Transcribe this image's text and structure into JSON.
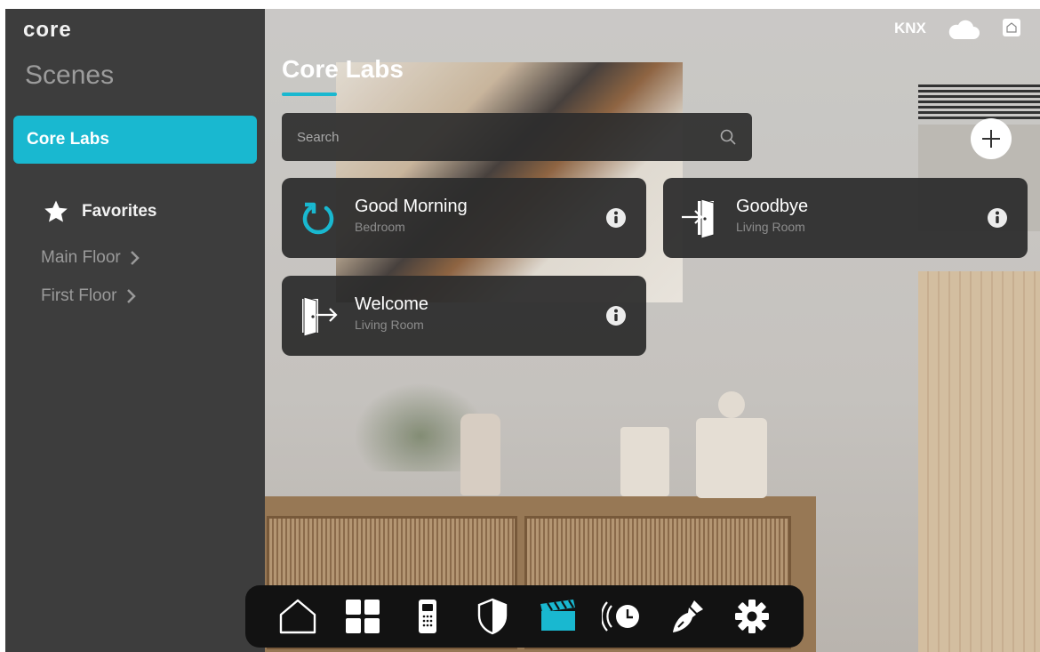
{
  "brand": {
    "logo_text": "core"
  },
  "sidebar": {
    "section_title": "Scenes",
    "active_item": "Core Labs",
    "favorites_label": "Favorites",
    "floors": [
      {
        "label": "Main Floor"
      },
      {
        "label": "First Floor"
      }
    ]
  },
  "header": {
    "title": "Core Labs",
    "protocol_label": "KNX"
  },
  "search": {
    "placeholder": "Search",
    "value": ""
  },
  "scenes": [
    {
      "name": "Good Morning",
      "room": "Bedroom",
      "icon": "refresh-icon"
    },
    {
      "name": "Goodbye",
      "room": "Living Room",
      "icon": "door-enter-icon"
    },
    {
      "name": "Welcome",
      "room": "Living Room",
      "icon": "door-exit-icon"
    }
  ],
  "dock": {
    "items": [
      {
        "icon": "home-icon",
        "active": false
      },
      {
        "icon": "grid-icon",
        "active": false
      },
      {
        "icon": "intercom-icon",
        "active": false
      },
      {
        "icon": "shield-icon",
        "active": false
      },
      {
        "icon": "clapperboard-icon",
        "active": true
      },
      {
        "icon": "schedule-icon",
        "active": false
      },
      {
        "icon": "cleaning-icon",
        "active": false
      },
      {
        "icon": "gear-icon",
        "active": false
      }
    ]
  },
  "colors": {
    "accent": "#19b8d0",
    "sidebar": "#3d3d3d",
    "card": "#2d2d2d",
    "dock": "#121212"
  }
}
